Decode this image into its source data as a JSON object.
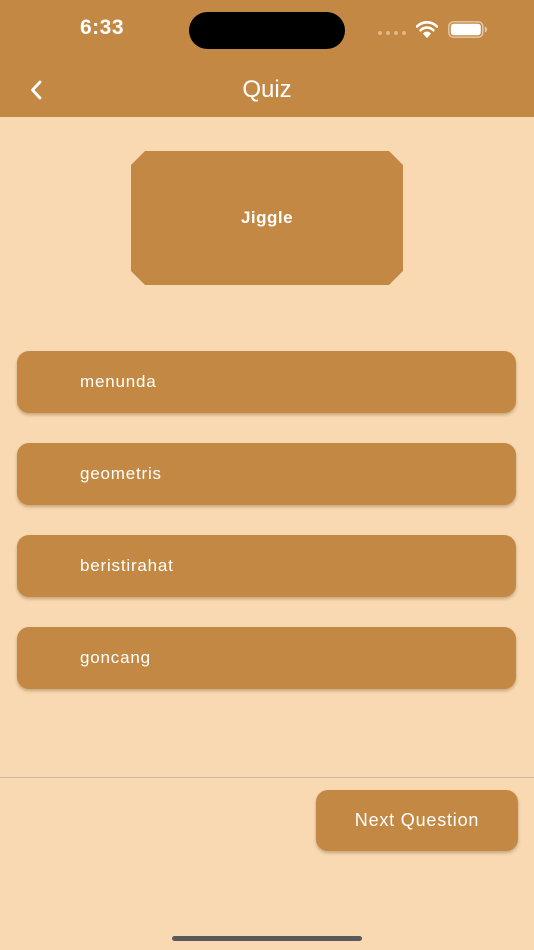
{
  "status_bar": {
    "time": "6:33",
    "icons": [
      "signal-dots-icon",
      "wifi-icon",
      "battery-icon"
    ]
  },
  "nav": {
    "back_icon": "chevron-left-icon",
    "title": "Quiz"
  },
  "question": {
    "word": "Jiggle"
  },
  "options": [
    {
      "label": "menunda"
    },
    {
      "label": "geometris"
    },
    {
      "label": "beristirahat"
    },
    {
      "label": "goncang"
    }
  ],
  "footer": {
    "next_label": "Next Question"
  },
  "colors": {
    "accent": "#C38944",
    "background": "#F8D9B2",
    "text_on_accent": "#FFFFFF"
  }
}
